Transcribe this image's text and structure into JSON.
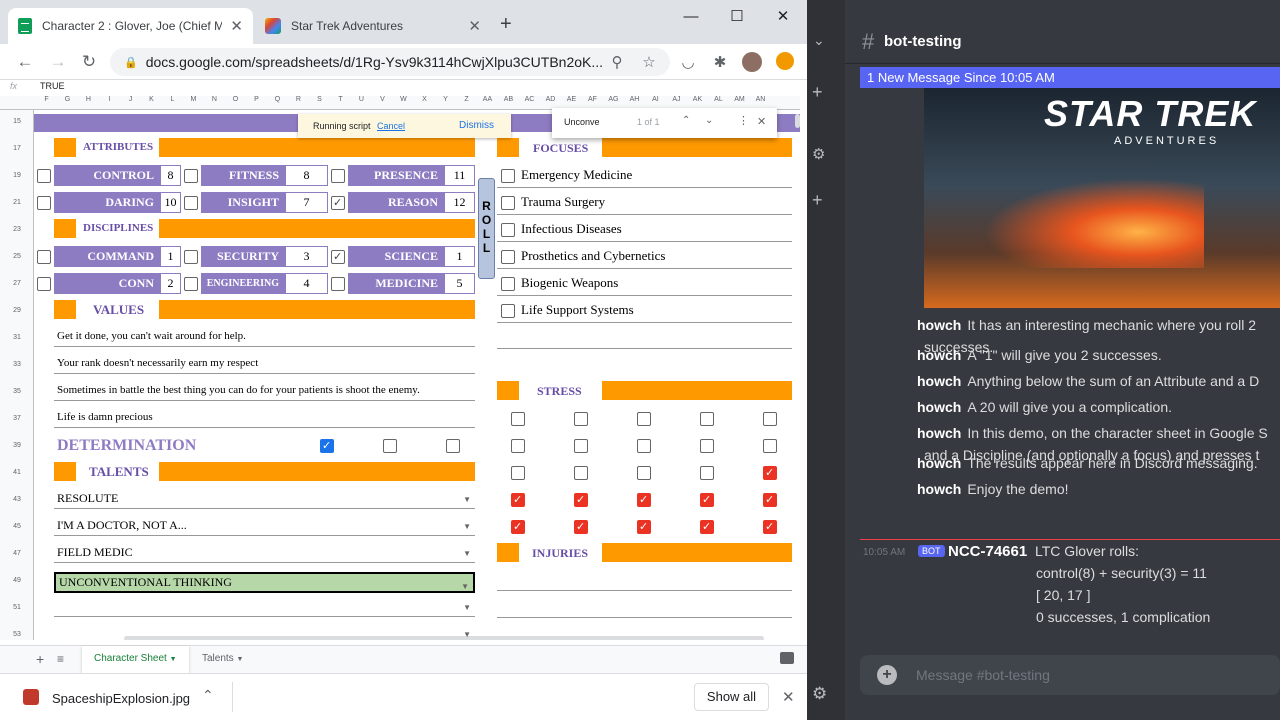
{
  "browser": {
    "tabs": [
      {
        "title": "Character 2 : Glover, Joe (Chief M"
      },
      {
        "title": "Star Trek Adventures"
      }
    ],
    "new_tab": "+",
    "url": "docs.google.com/spreadsheets/d/1Rg-Ysv9k3114hCwjXlpu3CUTBn2oK..."
  },
  "formula_bar": {
    "fx": "fx",
    "value": "TRUE"
  },
  "columns": [
    "F",
    "G",
    "H",
    "I",
    "J",
    "K",
    "L",
    "M",
    "N",
    "O",
    "P",
    "Q",
    "R",
    "S",
    "T",
    "U",
    "V",
    "W",
    "X",
    "Y",
    "Z",
    "AA",
    "AB",
    "AC",
    "AD",
    "AE",
    "AF",
    "AG",
    "AH",
    "AI",
    "AJ",
    "AK",
    "AL",
    "AM",
    "AN"
  ],
  "rows": [
    "15",
    "17",
    "19",
    "21",
    "23",
    "25",
    "27",
    "29",
    "31",
    "33",
    "35",
    "37",
    "39",
    "41",
    "43",
    "45",
    "47",
    "49",
    "51",
    "53"
  ],
  "toast": {
    "text": "Running script",
    "cancel": "Cancel",
    "dismiss": "Dismiss"
  },
  "find": {
    "query": "Unconve",
    "count": "1 of 1"
  },
  "sheet": {
    "attributes_header": "ATTRIBUTES",
    "disciplines_header": "DISCIPLINES",
    "focuses_header": "FOCUSES",
    "values_header": "VALUES",
    "talents_header": "TALENTS",
    "stress_header": "STRESS",
    "injuries_header": "INJURIES",
    "determination_label": "DETERMINATION",
    "roll_label": "ROLL",
    "attributes": [
      {
        "name": "CONTROL",
        "value": "8",
        "checked": false
      },
      {
        "name": "FITNESS",
        "value": "8",
        "checked": false
      },
      {
        "name": "PRESENCE",
        "value": "11",
        "checked": false
      },
      {
        "name": "DARING",
        "value": "10",
        "checked": false
      },
      {
        "name": "INSIGHT",
        "value": "7",
        "checked": false
      },
      {
        "name": "REASON",
        "value": "12",
        "checked": true
      }
    ],
    "disciplines": [
      {
        "name": "COMMAND",
        "value": "1",
        "checked": false
      },
      {
        "name": "SECURITY",
        "value": "3",
        "checked": false
      },
      {
        "name": "SCIENCE",
        "value": "1",
        "checked": true
      },
      {
        "name": "CONN",
        "value": "2",
        "checked": false
      },
      {
        "name": "ENGINEERING",
        "value": "4",
        "checked": false
      },
      {
        "name": "MEDICINE",
        "value": "5",
        "checked": false
      }
    ],
    "focuses": [
      "Emergency Medicine",
      "Trauma Surgery",
      "Infectious Diseases",
      "Prosthetics and Cybernetics",
      "Biogenic Weapons",
      "Life Support Systems"
    ],
    "values": [
      "Get it done, you can't wait around for help.",
      "Your rank doesn't necessarily earn my respect",
      "Sometimes in battle the best thing you can do for your patients is shoot the enemy.",
      "Life is damn precious"
    ],
    "determination": [
      true,
      false,
      false
    ],
    "talents": [
      "RESOLUTE",
      "I'M A DOCTOR, NOT A...",
      "FIELD MEDIC",
      "UNCONVENTIONAL THINKING"
    ],
    "stress_rows": [
      [
        false,
        false,
        false,
        false,
        false
      ],
      [
        false,
        false,
        false,
        false,
        false
      ],
      [
        false,
        false,
        false,
        false,
        true
      ],
      [
        true,
        true,
        true,
        true,
        true
      ],
      [
        true,
        true,
        true,
        true,
        true
      ]
    ]
  },
  "sheet_tabs": {
    "add": "+",
    "list": "≡",
    "tabs": [
      "Character Sheet",
      "Talents"
    ]
  },
  "download": {
    "filename": "SpaceshipExplosion.jpg",
    "show_all": "Show all"
  },
  "discord": {
    "channel": "bot-testing",
    "new_banner": "1 New Message Since 10:05 AM",
    "banner_title": "STAR TREK",
    "banner_subtitle": "ADVENTURES",
    "messages": [
      {
        "author": "howch",
        "text": "It has an interesting mechanic where you roll 2",
        "cont": "successes."
      },
      {
        "author": "howch",
        "text": "A \"1\" will give you 2 successes."
      },
      {
        "author": "howch",
        "text": "Anything below the sum of an Attribute and a D"
      },
      {
        "author": "howch",
        "text": "A 20 will give you a complication."
      },
      {
        "author": "howch",
        "text": "In this demo, on the character sheet in Google S",
        "cont": "and a Discipline (and optionally a focus) and presses t"
      },
      {
        "author": "howch",
        "text": "The results appear here in Discord messaging."
      },
      {
        "author": "howch",
        "text": "Enjoy the demo!"
      }
    ],
    "bot": {
      "time": "10:05 AM",
      "tag": "BOT",
      "name": "NCC-74661",
      "lines": [
        "LTC Glover rolls:",
        "control(8) + security(3) = 11",
        "[ 20, 17 ]",
        "0 successes, 1 complication"
      ]
    },
    "composer_placeholder": "Message #bot-testing"
  },
  "colors": {
    "purple": "#8e7cc3",
    "orange": "#ff9900",
    "green_sel": "#b6d7a8",
    "discord_bg": "#36393f"
  }
}
